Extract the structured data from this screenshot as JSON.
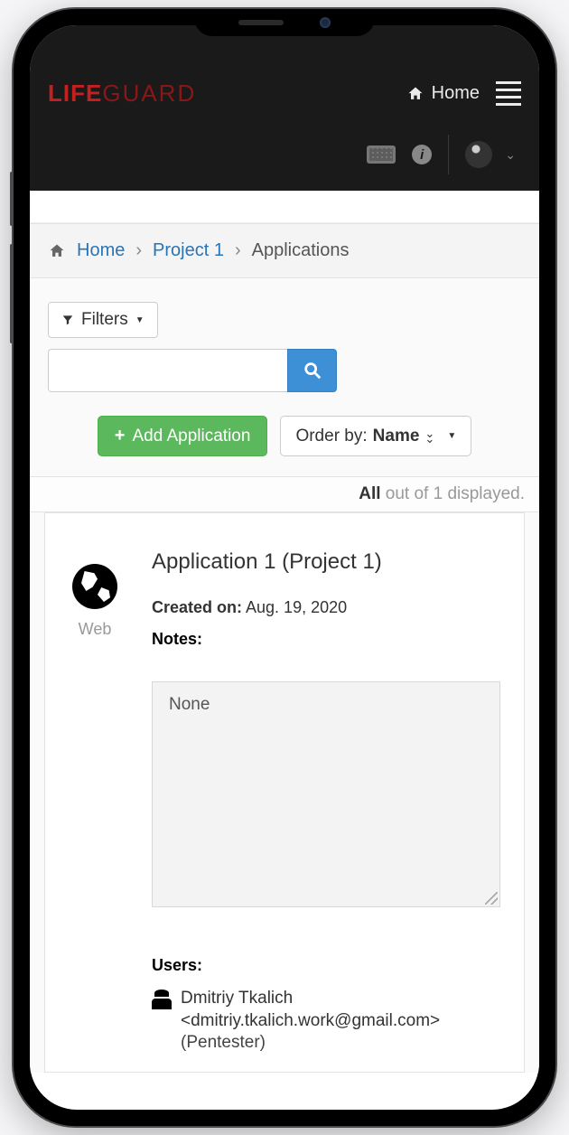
{
  "brand": {
    "part1": "LIFE",
    "part2": "GUARD"
  },
  "nav": {
    "home_label": "Home"
  },
  "breadcrumb": {
    "home": "Home",
    "project": "Project 1",
    "current": "Applications"
  },
  "toolbar": {
    "filters_label": "Filters",
    "add_label": "Add Application",
    "order_prefix": "Order by:",
    "order_field": "Name"
  },
  "results": {
    "strong": "All",
    "rest": " out of 1 displayed."
  },
  "application": {
    "type": "Web",
    "title": "Application 1 (Project 1)",
    "created_label": "Created on:",
    "created_value": "Aug. 19, 2020",
    "notes_label": "Notes:",
    "notes_value": "None",
    "users_label": "Users:",
    "user_name": "Dmitriy Tkalich",
    "user_email": "<dmitriy.tkalich.work@gmail.com>",
    "user_role": "(Pentester)"
  }
}
